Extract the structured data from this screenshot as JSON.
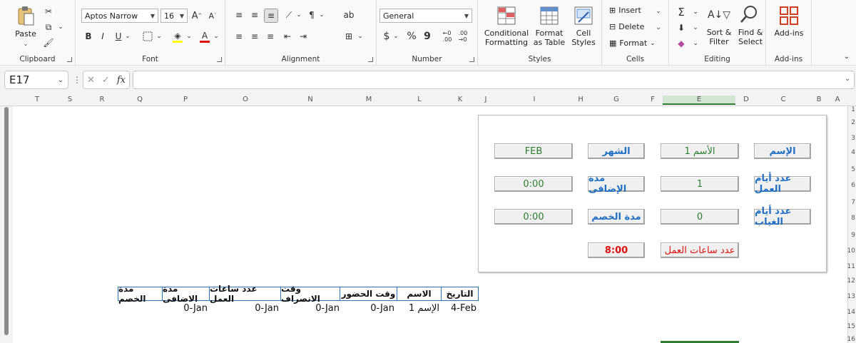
{
  "ribbon": {
    "clipboard": {
      "label": "Clipboard",
      "paste": "Paste"
    },
    "font": {
      "label": "Font",
      "name": "Aptos Narrow",
      "size": "16"
    },
    "alignment": {
      "label": "Alignment"
    },
    "number": {
      "label": "Number",
      "format": "General",
      "currency": "$",
      "percent": "%",
      "comma": "9"
    },
    "styles": {
      "label": "Styles",
      "conditional": "Conditional Formatting",
      "format_table": "Format as Table",
      "cell_styles": "Cell Styles"
    },
    "cells": {
      "label": "Cells",
      "insert": "Insert",
      "delete": "Delete",
      "format": "Format"
    },
    "editing": {
      "label": "Editing",
      "sort": "Sort & Filter",
      "find": "Find & Select"
    },
    "addins": {
      "label": "Add-ins",
      "addins_btn": "Add-ins"
    }
  },
  "formula_bar": {
    "name_box": "E17",
    "fx": "fx",
    "value": ""
  },
  "columns": [
    "T",
    "S",
    "R",
    "Q",
    "P",
    "O",
    "N",
    "M",
    "L",
    "K",
    "J",
    "I",
    "H",
    "G",
    "F",
    "E",
    "D",
    "C",
    "B",
    "A"
  ],
  "rows": [
    "1",
    "2",
    "3",
    "4",
    "5",
    "6",
    "7",
    "8",
    "9",
    "10",
    "11",
    "12",
    "13",
    "14",
    "15",
    "16"
  ],
  "form": {
    "name_label": "الإسم",
    "name_value": "الأسم 1",
    "month_label": "الشهر",
    "month_value": "FEB",
    "workdays_label": "عدد أيام العمل",
    "workdays_value": "1",
    "overtime_label": "مدة الإضافى",
    "overtime_value": "0:00",
    "absence_label": "عدد أيام الغياب",
    "absence_value": "0",
    "deduction_label": "مدة الخصم",
    "deduction_value": "0:00",
    "hours_label": "عدد ساعات العمل",
    "hours_value": "8:00"
  },
  "table": {
    "headers": [
      "التاريخ",
      "الاسم",
      "وقت الحضور",
      "وقت الانصراف",
      "عدد ساعات العمل",
      "مدة الاضافى",
      "مدة الخصم"
    ],
    "row": [
      "4-Feb",
      "الإسم 1",
      "0-Jan",
      "0-Jan",
      "0-Jan",
      "0-Jan",
      ""
    ]
  },
  "colors": {
    "accent_blue": "#1f6fc5",
    "value_green": "#2e7d32",
    "alert_red": "#e01010"
  }
}
